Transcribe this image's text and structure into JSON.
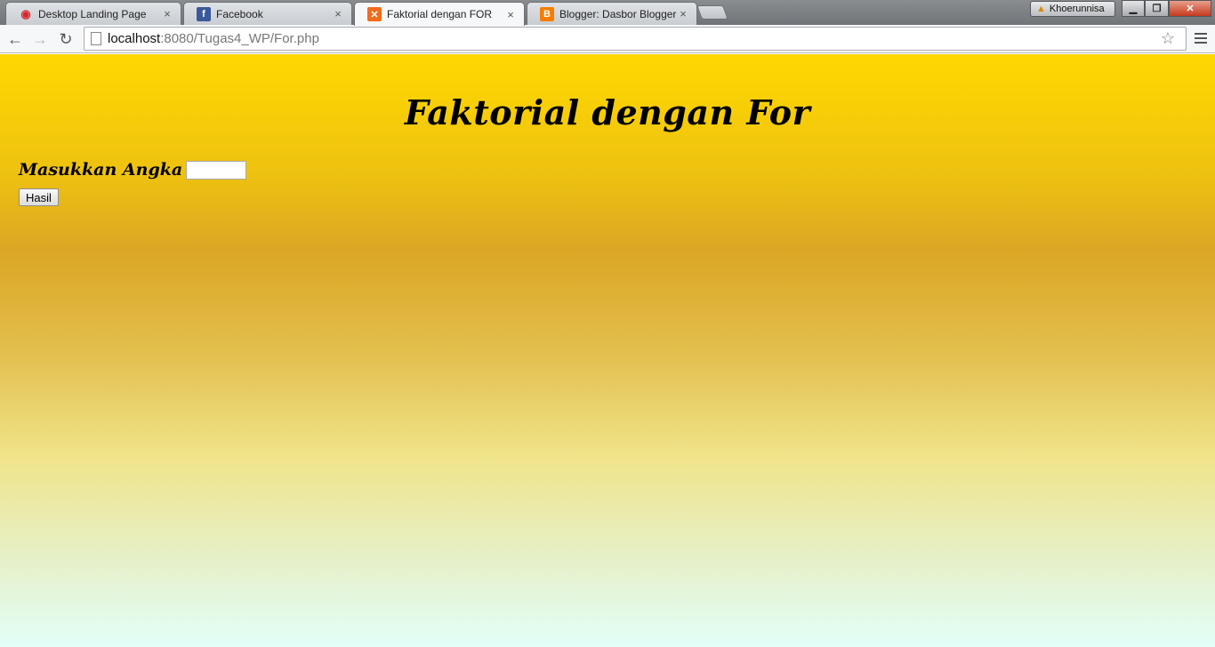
{
  "browser": {
    "tabs": [
      {
        "title": "Desktop Landing Page",
        "icon": "wifi-icon",
        "active": false
      },
      {
        "title": "Facebook",
        "icon": "facebook-icon",
        "active": false
      },
      {
        "title": "Faktorial dengan FOR",
        "icon": "xampp-icon",
        "active": true
      },
      {
        "title": "Blogger: Dasbor Blogger",
        "icon": "blogger-icon",
        "active": false
      }
    ],
    "profile_name": "Khoerunnisa",
    "url_host": "localhost",
    "url_path": ":8080/Tugas4_WP/For.php",
    "close_glyph": "×"
  },
  "page": {
    "title": "Faktorial dengan For",
    "input_label": "Masukkan Angka",
    "input_value": "",
    "submit_label": "Hasil"
  },
  "colors": {
    "gradient_top": "#ffd800",
    "gradient_mid": "#dba624",
    "gradient_bottom": "#e2fff8"
  }
}
